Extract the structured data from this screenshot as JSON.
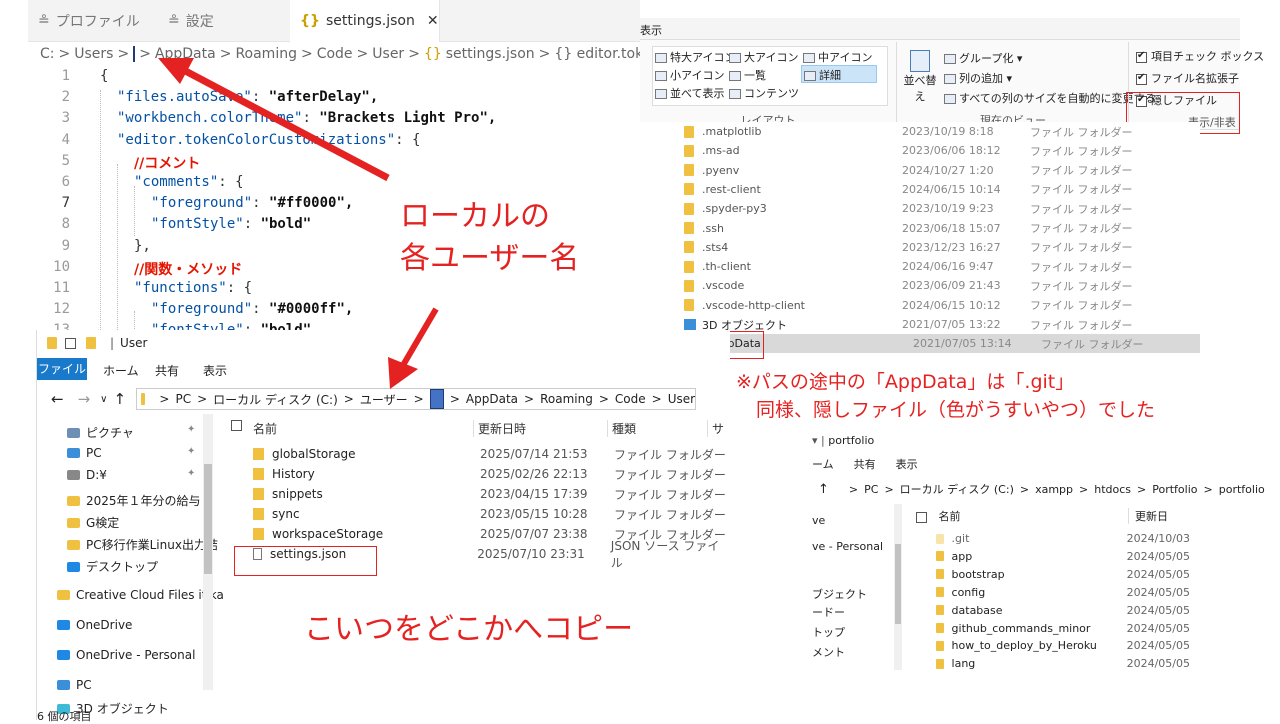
{
  "vscode": {
    "tabs": [
      {
        "label": "プロファイル",
        "icon": "settings-sliders-icon"
      },
      {
        "label": "設定",
        "icon": "settings-sliders-icon"
      },
      {
        "label": "settings.json",
        "icon": "json-braces-icon",
        "close": "✕"
      }
    ],
    "breadcrumb": [
      "C:",
      ">",
      "Users",
      ">",
      "[redacted]",
      ">",
      "AppData",
      ">",
      "Roaming",
      ">",
      "Code",
      ">",
      "User",
      ">",
      "settings.json",
      ">",
      "{} editor.tokenC"
    ],
    "breadcrumb_parts": {
      "c": "C:",
      "users": "Users",
      "appdata": "AppData",
      "roaming": "Roaming",
      "code": "Code",
      "user": "User",
      "file": "settings.json",
      "symbol": "{} editor.tokenC"
    },
    "lines": [
      {
        "n": "1",
        "t": "{"
      },
      {
        "n": "2",
        "k": "\"files.autoSave\"",
        "v": "\"afterDelay\","
      },
      {
        "n": "3",
        "k": "\"workbench.colorTheme\"",
        "v": "\"Brackets Light Pro\","
      },
      {
        "n": "4",
        "k": "\"editor.tokenColorCustomizations\"",
        "v": "{"
      },
      {
        "n": "5",
        "comment": "//コメント"
      },
      {
        "n": "6",
        "k": "\"comments\"",
        "v": "{"
      },
      {
        "n": "7",
        "k": "\"foreground\"",
        "v": "\"#ff0000\","
      },
      {
        "n": "8",
        "k": "\"fontStyle\"",
        "v": "\"bold\""
      },
      {
        "n": "9",
        "t": "},"
      },
      {
        "n": "10",
        "comment": "//関数・メソッド"
      },
      {
        "n": "11",
        "k": "\"functions\"",
        "v": "{"
      },
      {
        "n": "12",
        "k": "\"foreground\"",
        "v": "\"#0000ff\","
      },
      {
        "n": "13",
        "k": "\"fontStyle\"",
        "v": "\"bold\""
      }
    ]
  },
  "ribbon": {
    "tab": "表示",
    "layout": [
      "特大アイコン",
      "大アイコン",
      "中アイコン",
      "小アイコン",
      "一覧",
      "詳細",
      "並べて表示",
      "コンテンツ"
    ],
    "layout_label": "レイアウト",
    "sort": "並べ替え",
    "group_by": "グループ化 ▾",
    "add_column": "列の追加 ▾",
    "fit_columns": "すべての列のサイズを自動的に変更する",
    "current_view_label": "現在のビュー",
    "checks": [
      {
        "label": "項目チェック ボックス",
        "checked": true
      },
      {
        "label": "ファイル名拡張子",
        "checked": true
      },
      {
        "label": "隠しファイル",
        "checked": true
      }
    ],
    "show_hide_label": "表示/非表"
  },
  "top_folders": [
    {
      "name": ".matplotlib",
      "date": "2023/10/19 8:18",
      "type": "ファイル フォルダー"
    },
    {
      "name": ".ms-ad",
      "date": "2023/06/06 18:12",
      "type": "ファイル フォルダー"
    },
    {
      "name": ".pyenv",
      "date": "2024/10/27 1:20",
      "type": "ファイル フォルダー"
    },
    {
      "name": ".rest-client",
      "date": "2024/06/15 10:14",
      "type": "ファイル フォルダー"
    },
    {
      "name": ".spyder-py3",
      "date": "2023/10/19 9:23",
      "type": "ファイル フォルダー"
    },
    {
      "name": ".ssh",
      "date": "2023/06/18 15:07",
      "type": "ファイル フォルダー"
    },
    {
      "name": ".sts4",
      "date": "2023/12/23 16:27",
      "type": "ファイル フォルダー"
    },
    {
      "name": ".th-client",
      "date": "2024/06/16 9:47",
      "type": "ファイル フォルダー"
    },
    {
      "name": ".vscode",
      "date": "2023/06/09 21:43",
      "type": "ファイル フォルダー"
    },
    {
      "name": ".vscode-http-client",
      "date": "2024/06/15 10:12",
      "type": "ファイル フォルダー"
    },
    {
      "name": "3D オブジェクト",
      "date": "2021/07/05 13:22",
      "type": "ファイル フォルダー"
    },
    {
      "name": "AppData",
      "date": "2021/07/05 13:14",
      "type": "ファイル フォルダー"
    }
  ],
  "explorer": {
    "title": "User",
    "menu": [
      "ファイル",
      "ホーム",
      "共有",
      "表示"
    ],
    "address": [
      "PC",
      ">",
      "ローカル ディスク (C:)",
      ">",
      "ユーザー",
      ">",
      "[redacted]",
      ">",
      "AppData",
      ">",
      "Roaming",
      ">",
      "Code",
      ">",
      "User"
    ],
    "address_parts": {
      "pc": "PC",
      "disk": "ローカル ディスク (C:)",
      "users": "ユーザー",
      "appdata": "AppData",
      "roaming": "Roaming",
      "code": "Code",
      "user": "User"
    },
    "nav": [
      "ピクチャ",
      "PC",
      "D:¥",
      "2025年１年分の給与",
      "G検定",
      "PC移行作業Linux出力結",
      "デスクトップ",
      "Creative Cloud Files  itika",
      "OneDrive",
      "OneDrive - Personal",
      "PC",
      "3D オブジェクト"
    ],
    "columns": [
      "名前",
      "更新日時",
      "種類",
      "サ"
    ],
    "files": [
      {
        "name": "globalStorage",
        "date": "2025/07/14 21:53",
        "type": "ファイル フォルダー"
      },
      {
        "name": "History",
        "date": "2025/02/26 22:13",
        "type": "ファイル フォルダー"
      },
      {
        "name": "snippets",
        "date": "2023/04/15 17:39",
        "type": "ファイル フォルダー"
      },
      {
        "name": "sync",
        "date": "2023/05/15 10:28",
        "type": "ファイル フォルダー"
      },
      {
        "name": "workspaceStorage",
        "date": "2025/07/07 23:38",
        "type": "ファイル フォルダー"
      },
      {
        "name": "settings.json",
        "date": "2025/07/10 23:31",
        "type": "JSON ソース ファイル"
      }
    ],
    "status": "6 個の項目"
  },
  "explorer2": {
    "title": "portfolio",
    "menu": [
      "ーム",
      "共有",
      "表示"
    ],
    "address": [
      "PC",
      ">",
      "ローカル ディスク (C:)",
      ">",
      "xampp",
      ">",
      "htdocs",
      ">",
      "Portfolio",
      ">",
      "portfolio"
    ],
    "nav": [
      "ve",
      "ve - Personal",
      "ブジェクト",
      "ードー",
      "トップ",
      "メント"
    ],
    "columns": [
      "名前",
      "更新日"
    ],
    "files": [
      {
        "name": ".git",
        "date": "2024/10/03"
      },
      {
        "name": "app",
        "date": "2024/05/05"
      },
      {
        "name": "bootstrap",
        "date": "2024/05/05"
      },
      {
        "name": "config",
        "date": "2024/05/05"
      },
      {
        "name": "database",
        "date": "2024/05/05"
      },
      {
        "name": "github_commands_minor",
        "date": "2024/05/05"
      },
      {
        "name": "how_to_deploy_by_Heroku",
        "date": "2024/05/05"
      },
      {
        "name": "lang",
        "date": "2024/05/05"
      }
    ]
  },
  "annotations": {
    "local_user_line1": "ローカルの",
    "local_user_line2": "各ユーザー名",
    "note_line1": "※パスの途中の「AppData」は「.git」",
    "note_line2": "同様、隠しファイル（色がうすいやつ）でした",
    "copy_note": "こいつをどこかへコピー"
  },
  "colors": {
    "accent_red": "#e52222",
    "redact_blue": "#4472c4",
    "json_key": "#0451a5"
  }
}
